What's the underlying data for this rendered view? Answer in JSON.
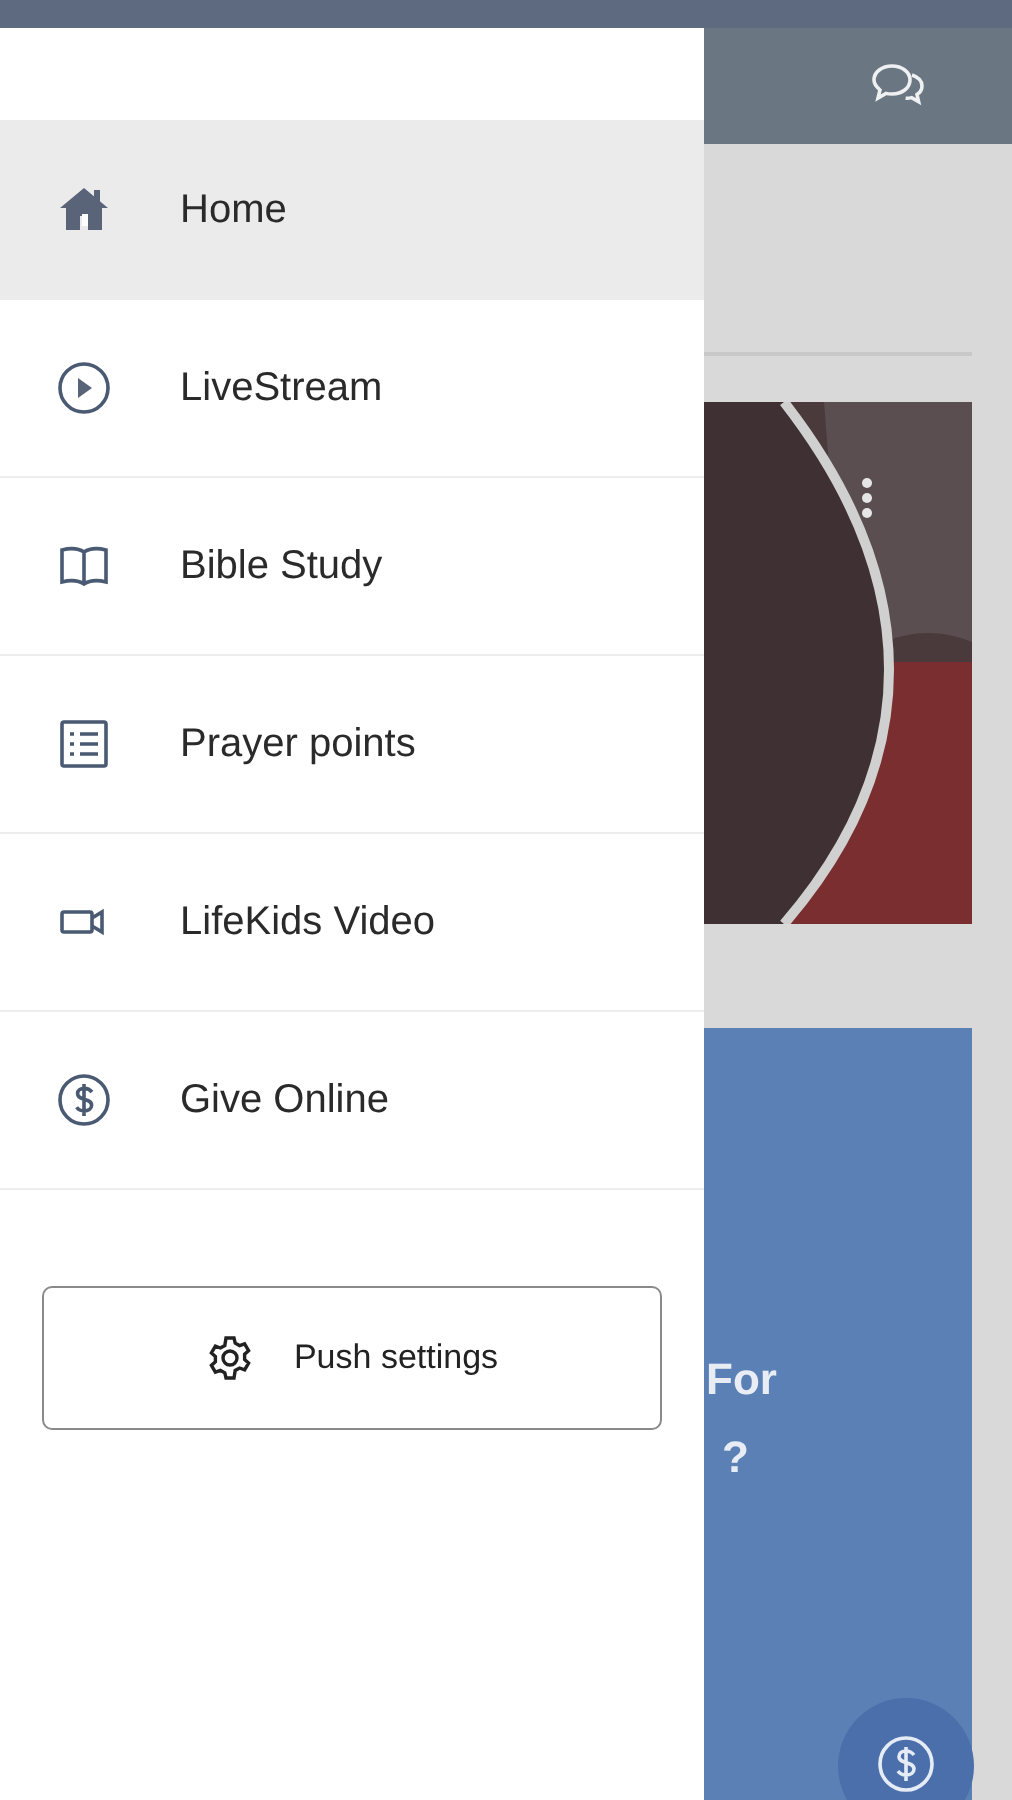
{
  "drawer": {
    "items": [
      {
        "label": "Home",
        "selected": true
      },
      {
        "label": "LiveStream",
        "selected": false
      },
      {
        "label": "Bible Study",
        "selected": false
      },
      {
        "label": "Prayer points",
        "selected": false
      },
      {
        "label": "LifeKids Video",
        "selected": false
      },
      {
        "label": "Give Online",
        "selected": false
      }
    ],
    "button": {
      "label": "Push settings"
    }
  },
  "background": {
    "banner": {
      "lines": [
        "For",
        "?"
      ]
    }
  }
}
